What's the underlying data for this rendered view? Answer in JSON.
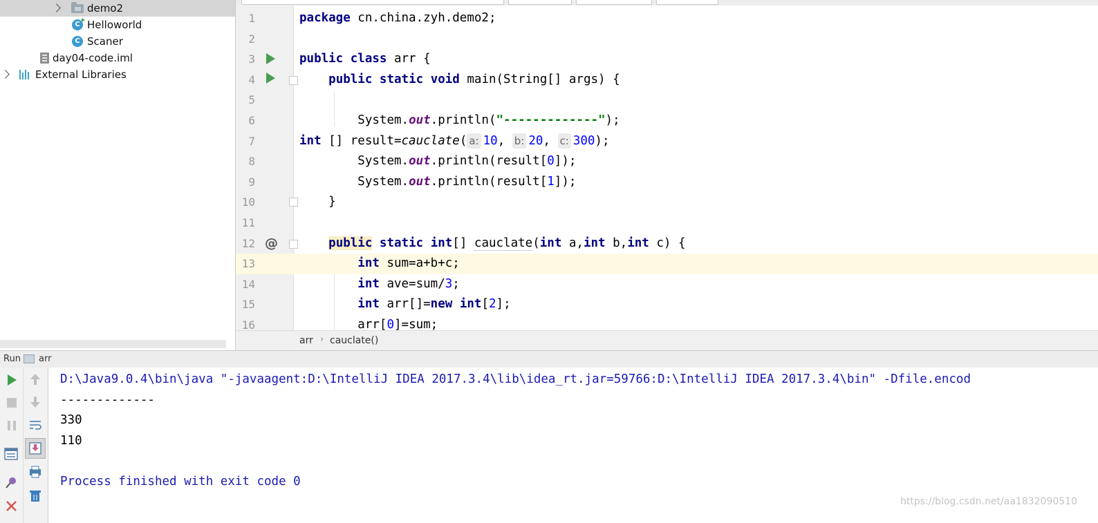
{
  "project_tree": {
    "items": [
      {
        "label": "demo2",
        "type": "folder"
      },
      {
        "label": "Helloworld",
        "type": "class"
      },
      {
        "label": "Scaner",
        "type": "class"
      },
      {
        "label": "day04-code.iml",
        "type": "iml"
      },
      {
        "label": "External Libraries",
        "type": "library"
      }
    ]
  },
  "editor": {
    "line_numbers": [
      "1",
      "2",
      "3",
      "4",
      "5",
      "6",
      "7",
      "8",
      "9",
      "10",
      "11",
      "12",
      "13",
      "14",
      "15",
      "16"
    ],
    "code": {
      "l1": {
        "kw": "package",
        "rest": " cn.china.zyh.demo2;"
      },
      "l3": {
        "kw1": "public",
        "kw2": "class",
        "rest": " arr {"
      },
      "l4": {
        "kw1": "public",
        "kw2": "static",
        "kw3": "void",
        "rest": " main(String[] args) {"
      },
      "l6": {
        "a": "System.",
        "fld": "out",
        "b": ".println(",
        "str": "\"-------------\"",
        "c": ");"
      },
      "l7": {
        "kw": "int",
        "a": " [] result=",
        "fn": "cauclate",
        "b": "(",
        "hint_a": "a:",
        "v1": "10",
        "c1": ", ",
        "hint_b": "b:",
        "v2": "20",
        "c2": ", ",
        "hint_c": "c:",
        "v3": "300",
        "c3": ");"
      },
      "l8": {
        "a": "System.",
        "fld": "out",
        "b": ".println(result[",
        "num": "0",
        "c": "]);"
      },
      "l9": {
        "a": "System.",
        "fld": "out",
        "b": ".println(result[",
        "num": "1",
        "c": "]);"
      },
      "l10": {
        "text": "}"
      },
      "l12": {
        "kw1": "public",
        "kw2": "static",
        "kw3": "int",
        "a": "[] ",
        "fn": "cauclate",
        "b": "(",
        "kw4": "int",
        "c": " a,",
        "kw5": "int",
        "d": " b,",
        "kw6": "int",
        "e": " c) {"
      },
      "l13": {
        "kw": "int",
        "rest": " sum=a+b+c;"
      },
      "l14": {
        "kw": "int",
        "a": " ave=sum/",
        "num": "3",
        "b": ";"
      },
      "l15": {
        "kw1": "int",
        "a": " arr[]=",
        "kw2": "new",
        "kw3": "int",
        "b": "[",
        "num": "2",
        "c": "];"
      },
      "l16": {
        "a": "arr[",
        "num": "0",
        "b": "]=sum;"
      }
    },
    "gutter": {
      "at_symbol": "@"
    },
    "breadcrumb": [
      "arr",
      "cauclate()"
    ],
    "breadcrumb_sep": "›"
  },
  "run_panel": {
    "header_label": "Run",
    "config_name": "arr",
    "console": {
      "command": "D:\\Java9.0.4\\bin\\java \"-javaagent:D:\\IntelliJ IDEA 2017.3.4\\lib\\idea_rt.jar=59766:D:\\IntelliJ IDEA 2017.3.4\\bin\" -Dfile.encod",
      "out1": "-------------",
      "out2": "330",
      "out3": "110",
      "exit": "Process finished with exit code 0"
    }
  },
  "watermark": "https://blog.csdn.net/aa1832090510",
  "colors": {
    "keyword": "#000080",
    "number": "#0000ff",
    "string": "#008000",
    "field": "#660e7a",
    "current_line": "#fdf9e3",
    "run_green": "#499c54",
    "console_blue": "#1b1bb3"
  }
}
